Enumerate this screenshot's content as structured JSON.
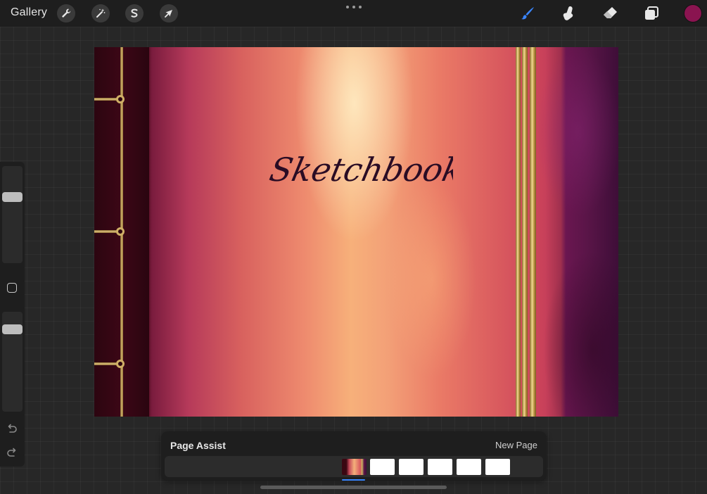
{
  "topbar": {
    "gallery_label": "Gallery",
    "left_tools": [
      {
        "name": "actions",
        "icon": "wrench-icon"
      },
      {
        "name": "adjustments",
        "icon": "magic-wand-icon"
      },
      {
        "name": "selection",
        "icon": "selection-s-icon"
      },
      {
        "name": "transform",
        "icon": "arrow-cursor-icon"
      }
    ],
    "right_tools": [
      {
        "name": "brush",
        "icon": "brush-icon",
        "active": true,
        "color": "#3a86ff"
      },
      {
        "name": "smudge",
        "icon": "smudge-finger-icon"
      },
      {
        "name": "eraser",
        "icon": "eraser-icon"
      },
      {
        "name": "layers",
        "icon": "layers-icon"
      }
    ],
    "current_color": "#8a1450"
  },
  "canvas": {
    "title_text": "Sketchbook",
    "binding_color": "#d8b870"
  },
  "sidebar": {
    "brush_size_level": 0.64,
    "opacity_level": 0.88,
    "icons": [
      "modify-square-icon",
      "undo-icon",
      "redo-icon"
    ]
  },
  "page_assist": {
    "title": "Page Assist",
    "new_page_label": "New Page",
    "current_page": 1,
    "page_count": 6
  }
}
